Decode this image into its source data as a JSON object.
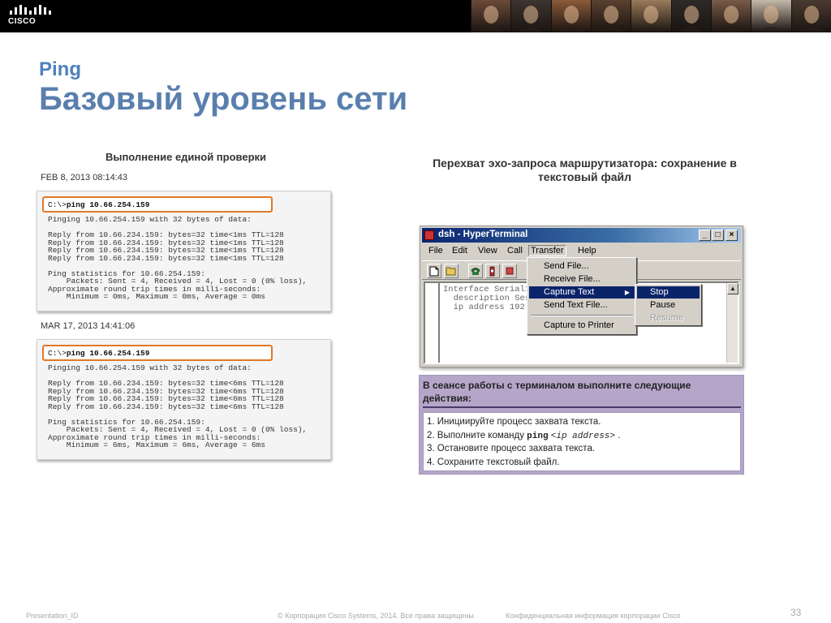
{
  "banner": {
    "logo_text": "CISCO",
    "photo_tints": [
      "#6b4a3a",
      "#3e3430",
      "#8a5a3a",
      "#5a4030",
      "#9a7a5a",
      "#2f2a2a",
      "#7a5a48",
      "#c4b8a8",
      "#4a3a30"
    ]
  },
  "header": {
    "kicker": "Ping",
    "title": "Базовый уровень сети"
  },
  "left": {
    "heading": "Выполнение единой проверки",
    "runs": [
      {
        "date": "FEB 8, 2013 08:14:43",
        "prompt": "C:\\>",
        "command": "ping 10.66.254.159",
        "lines": [
          "Pinging 10.66.254.159 with 32 bytes of data:",
          "",
          "Reply from 10.66.234.159: bytes=32 time<1ms TTL=128",
          "Reply from 10.66.234.159: bytes=32 time<1ms TTL=128",
          "Reply from 10.66.234.159: bytes=32 time<1ms TTL=128",
          "Reply from 10.66.234.159: bytes=32 time<1ms TTL=128",
          "",
          "Ping statistics for 10.66.254.159:",
          "    Packets: Sent = 4, Received = 4, Lost = 0 (0% loss),",
          "Approximate round trip times in milli-seconds:",
          "    Minimum = 0ms, Maximum = 0ms, Average = 0ms"
        ]
      },
      {
        "date": "MAR 17, 2013 14:41:06",
        "prompt": "C:\\>",
        "command": "ping 10.66.254.159",
        "lines": [
          "Pinging 10.66.254.159 with 32 bytes of data:",
          "",
          "Reply from 10.66.234.159: bytes=32 time<6ms TTL=128",
          "Reply from 10.66.234.159: bytes=32 time<6ms TTL=128",
          "Reply from 10.66.234.159: bytes=32 time<6ms TTL=128",
          "Reply from 10.66.234.159: bytes=32 time<6ms TTL=128",
          "",
          "Ping statistics for 10.66.254.159:",
          "    Packets: Sent = 4, Received = 4, Lost = 0 (0% loss),",
          "Approximate round trip times in milli-seconds:",
          "    Minimum = 6ms, Maximum = 6ms, Average = 6ms"
        ]
      }
    ]
  },
  "right": {
    "heading": "Перехват эхо-запроса маршрутизатора: сохранение в текстовый файл",
    "hyperterminal": {
      "title": "dsh - HyperTerminal",
      "window_buttons": {
        "minimize": "_",
        "maximize": "□",
        "close": "×"
      },
      "menu": [
        "File",
        "Edit",
        "View",
        "Call",
        "Transfer",
        "Help"
      ],
      "active_menu": "Transfer",
      "toolbar_icons": [
        "new-document-icon",
        "open-folder-icon",
        "phone-call-icon",
        "phone-disconnect-icon",
        "send-icon"
      ],
      "transfer_items": [
        "Send File...",
        "Receive File...",
        "Capture Text",
        "Send Text File...",
        "Capture to Printer"
      ],
      "highlighted_item": "Capture Text",
      "capture_submenu": [
        "Stop",
        "Pause",
        "Resume"
      ],
      "capture_highlighted": "Stop",
      "capture_disabled": "Resume",
      "terminal_lines": [
        "Interface Serial1",
        "  description Serial1 Interface on the RTA router",
        "  ip address 192.168.4.89.255.255.255.240"
      ]
    },
    "instructions": {
      "header": "В сеансе работы с терминалом выполните следующие действия:",
      "step1": "1. Инициируйте процесс захвата текста.",
      "step2_prefix": "2. Выполните команду ",
      "step2_cmd": "ping",
      "step2_arg": "<ip address>",
      "step2_suffix": " .",
      "step3": "3. Остановите процесс захвата текста.",
      "step4": "4. Сохраните текстовый файл."
    }
  },
  "footer": {
    "presentation_id": "Presentation_ID",
    "copyright": "© Корпорация Cisco Systems, 2014. Все права защищены.",
    "confidential": "Конфиденциальная информация корпорации Cisco",
    "page_number": "33"
  }
}
